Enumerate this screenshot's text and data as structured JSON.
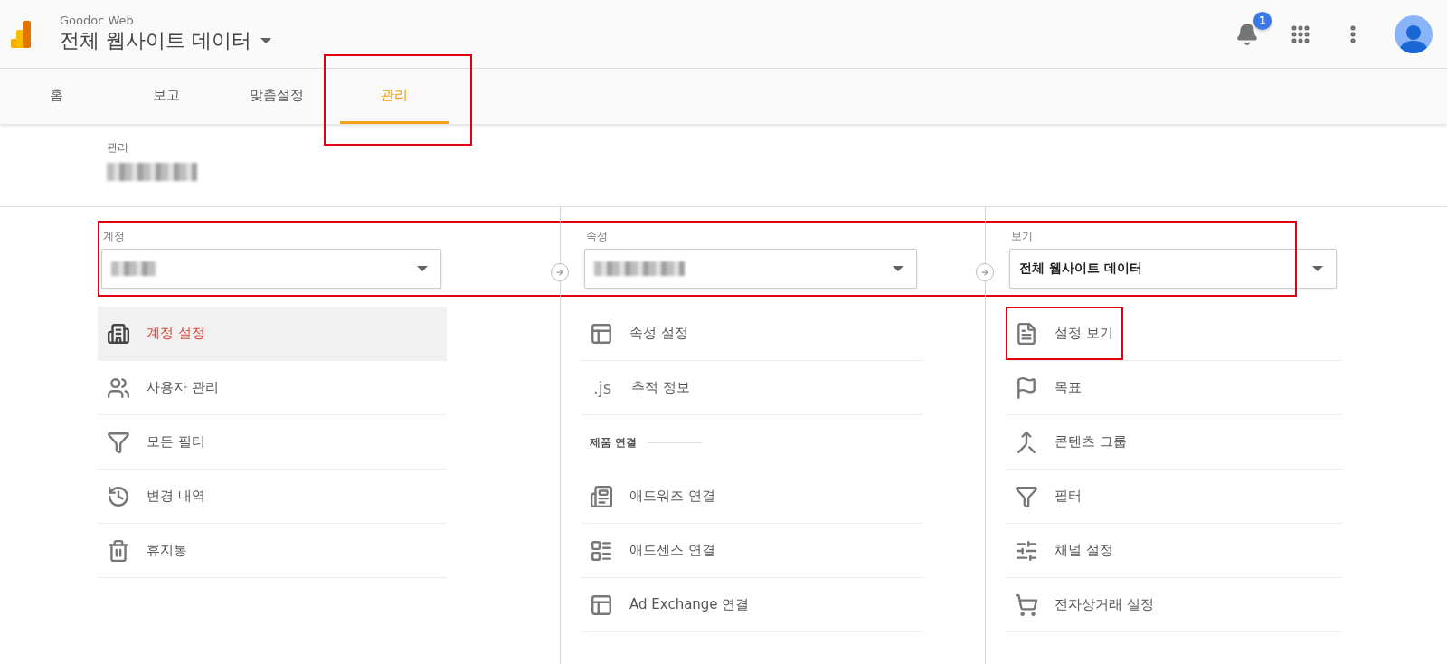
{
  "header": {
    "product": "Goodoc Web",
    "view": "전체 웹사이트 데이터",
    "notification_count": "1"
  },
  "tabs": [
    {
      "label": "홈",
      "selected": false,
      "highlighted": false
    },
    {
      "label": "보고",
      "selected": false,
      "highlighted": false
    },
    {
      "label": "맞춤설정",
      "selected": false,
      "highlighted": false
    },
    {
      "label": "관리",
      "selected": true,
      "highlighted": true
    }
  ],
  "breadcrumb": {
    "label": "관리",
    "account_redacted": true
  },
  "selectors_highlighted": true,
  "columns": [
    {
      "label": "계정",
      "selector": {
        "redacted": true
      },
      "items": [
        {
          "kind": "item",
          "label": "계정 설정",
          "selected": true,
          "highlighted": false
        },
        {
          "kind": "item",
          "label": "사용자 관리",
          "selected": false,
          "highlighted": false
        },
        {
          "kind": "item",
          "label": "모든 필터",
          "selected": false,
          "highlighted": false
        },
        {
          "kind": "item",
          "label": "변경 내역",
          "selected": false,
          "highlighted": false
        },
        {
          "kind": "item",
          "label": "휴지통",
          "selected": false,
          "highlighted": false
        }
      ]
    },
    {
      "label": "속성",
      "selector": {
        "redacted": true
      },
      "items": [
        {
          "kind": "item",
          "label": "속성 설정",
          "selected": false,
          "highlighted": false
        },
        {
          "kind": "item",
          "label": "추적 정보",
          "icon_text": ".js",
          "selected": false,
          "highlighted": false
        },
        {
          "kind": "section",
          "label": "제품 연결"
        },
        {
          "kind": "item",
          "label": "애드워즈 연결",
          "selected": false,
          "highlighted": false
        },
        {
          "kind": "item",
          "label": "애드센스 연결",
          "selected": false,
          "highlighted": false
        },
        {
          "kind": "item",
          "label": "Ad Exchange 연결",
          "selected": false,
          "highlighted": false
        }
      ]
    },
    {
      "label": "보기",
      "selector": {
        "redacted": false,
        "value": "전체 웹사이트 데이터"
      },
      "items": [
        {
          "kind": "item",
          "label": "설정 보기",
          "selected": false,
          "highlighted": true
        },
        {
          "kind": "item",
          "label": "목표",
          "selected": false,
          "highlighted": false
        },
        {
          "kind": "item",
          "label": "콘텐츠 그룹",
          "selected": false,
          "highlighted": false
        },
        {
          "kind": "item",
          "label": "필터",
          "selected": false,
          "highlighted": false
        },
        {
          "kind": "item",
          "label": "채널 설정",
          "selected": false,
          "highlighted": false
        },
        {
          "kind": "item",
          "label": "전자상거래 설정",
          "selected": false,
          "highlighted": false
        }
      ]
    }
  ]
}
